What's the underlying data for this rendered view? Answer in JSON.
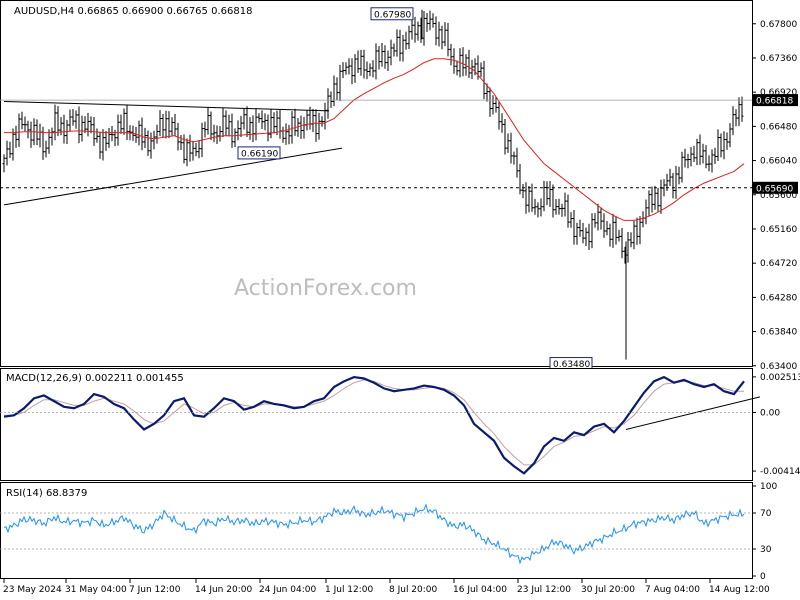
{
  "header": {
    "symbol": "AUDUSD,H4",
    "ohlc": "0.66865 0.66900 0.66765 0.66818"
  },
  "watermark": "ActionForex.com",
  "colors": {
    "bars": "#000000",
    "ma": "#e0201c",
    "macd_line": "#0a1a6e",
    "macd_signal": "#c0a0a0",
    "rsi": "#1e90ff",
    "grid": "#9a9a9a",
    "price_tag_bg": "#000000"
  },
  "chart_data": [
    {
      "type": "line",
      "name": "price",
      "title": "AUDUSD,H4",
      "ylim": [
        0.6341,
        0.6808
      ],
      "y_ticks": [
        "0.67800",
        "0.67360",
        "0.66920",
        "0.66480",
        "0.66040",
        "0.65600",
        "0.65160",
        "0.64720",
        "0.64280",
        "0.63840",
        "0.63400"
      ],
      "y_tick_values": [
        0.678,
        0.6736,
        0.6692,
        0.6648,
        0.6604,
        0.656,
        0.6516,
        0.6472,
        0.6428,
        0.6384,
        0.634
      ],
      "x_labels": [
        "23 May 2024",
        "31 May 04:00",
        "7 Jun 12:00",
        "14 Jun 20:00",
        "24 Jun 04:00",
        "1 Jul 12:00",
        "8 Jul 20:00",
        "16 Jul 04:00",
        "23 Jul 12:00",
        "30 Jul 20:00",
        "7 Aug 04:00",
        "14 Aug 12:00"
      ],
      "x": [
        0,
        10,
        20,
        30,
        40,
        50,
        60,
        70,
        80,
        90,
        100,
        110,
        120,
        130,
        140,
        150,
        160,
        170,
        180,
        190,
        200,
        210,
        220,
        230,
        240,
        250,
        260,
        270,
        280,
        290,
        300,
        310,
        320,
        330,
        340,
        350,
        360,
        370,
        380,
        390,
        400,
        410,
        420,
        430,
        440,
        450,
        460,
        470,
        480,
        490,
        500,
        510,
        520,
        530,
        540,
        550,
        560,
        570,
        580,
        590,
        600,
        610,
        620,
        630,
        640,
        650,
        660,
        670,
        680,
        690,
        700,
        710,
        720,
        730,
        740
      ],
      "close": [
        0.66,
        0.664,
        0.665,
        0.664,
        0.662,
        0.665,
        0.6648,
        0.6655,
        0.665,
        0.664,
        0.662,
        0.6645,
        0.665,
        0.664,
        0.663,
        0.663,
        0.666,
        0.664,
        0.662,
        0.661,
        0.665,
        0.664,
        0.665,
        0.664,
        0.6652,
        0.665,
        0.6655,
        0.665,
        0.664,
        0.6645,
        0.6655,
        0.665,
        0.666,
        0.67,
        0.6718,
        0.673,
        0.6722,
        0.6728,
        0.674,
        0.6745,
        0.676,
        0.677,
        0.678,
        0.6778,
        0.676,
        0.673,
        0.6725,
        0.673,
        0.67,
        0.667,
        0.664,
        0.66,
        0.656,
        0.654,
        0.656,
        0.655,
        0.654,
        0.652,
        0.65,
        0.653,
        0.652,
        0.651,
        0.649,
        0.6505,
        0.654,
        0.6555,
        0.657,
        0.658,
        0.66,
        0.662,
        0.6605,
        0.661,
        0.663,
        0.6655,
        0.6682
      ],
      "ma": [
        0.664,
        0.664,
        0.6641,
        0.6641,
        0.664,
        0.664,
        0.6641,
        0.6642,
        0.6642,
        0.6641,
        0.664,
        0.664,
        0.664,
        0.6639,
        0.6634,
        0.6632,
        0.6634,
        0.6636,
        0.6631,
        0.6628,
        0.6631,
        0.6634,
        0.6636,
        0.6636,
        0.6637,
        0.6638,
        0.6639,
        0.664,
        0.6642,
        0.6646,
        0.665,
        0.6652,
        0.6652,
        0.6658,
        0.667,
        0.6682,
        0.669,
        0.6697,
        0.6704,
        0.671,
        0.6715,
        0.6722,
        0.673,
        0.6735,
        0.6735,
        0.6733,
        0.6728,
        0.672,
        0.6705,
        0.669,
        0.667,
        0.665,
        0.663,
        0.6615,
        0.66,
        0.659,
        0.658,
        0.657,
        0.656,
        0.655,
        0.654,
        0.6533,
        0.6527,
        0.6527,
        0.653,
        0.6535,
        0.6542,
        0.655,
        0.656,
        0.6568,
        0.6575,
        0.658,
        0.6585,
        0.659,
        0.66
      ],
      "price_tags": [
        "0.66818",
        "0.65690"
      ],
      "price_tag_values": [
        0.66818,
        0.6569
      ],
      "annotations": [
        {
          "text": "0.67980",
          "x": 388,
          "y": 0.6798
        },
        {
          "text": "0.66190",
          "x": 255,
          "y": 0.6619
        },
        {
          "text": "0.63480",
          "x": 567,
          "y": 0.6348
        }
      ],
      "horizontal_level": 0.6569,
      "trendlines": [
        {
          "x0": 0,
          "y0": 0.668,
          "x1": 325,
          "y1": 0.6668
        },
        {
          "x0": 0,
          "y0": 0.6547,
          "x1": 338,
          "y1": 0.662
        }
      ]
    },
    {
      "type": "line",
      "name": "macd",
      "title": "MACD(12,26,9) 0.002211 0.001455",
      "ylim": [
        -0.0047,
        0.003
      ],
      "y_ticks": [
        "0.002513",
        "0.00",
        "-0.00414"
      ],
      "y_tick_values": [
        0.002513,
        0.0,
        -0.00414
      ],
      "x": [
        0,
        10,
        20,
        30,
        40,
        50,
        60,
        70,
        80,
        90,
        100,
        110,
        120,
        130,
        140,
        150,
        160,
        170,
        180,
        190,
        200,
        210,
        220,
        230,
        240,
        250,
        260,
        270,
        280,
        290,
        300,
        310,
        320,
        330,
        340,
        350,
        360,
        370,
        380,
        390,
        400,
        410,
        420,
        430,
        440,
        450,
        460,
        470,
        480,
        490,
        500,
        510,
        520,
        530,
        540,
        550,
        560,
        570,
        580,
        590,
        600,
        610,
        620,
        630,
        640,
        650,
        660,
        670,
        680,
        690,
        700,
        710,
        720,
        730,
        740
      ],
      "macd": [
        -0.0003,
        -0.0002,
        0.0003,
        0.001,
        0.0012,
        0.0008,
        0.0004,
        0.0003,
        0.0006,
        0.0013,
        0.0011,
        0.0006,
        0.0003,
        -0.0005,
        -0.0012,
        -0.0008,
        -0.0002,
        0.0008,
        0.001,
        -0.0002,
        -0.0003,
        0.0003,
        0.001,
        0.0008,
        0.0002,
        0.0004,
        0.0008,
        0.0006,
        0.0005,
        0.0003,
        0.0004,
        0.0008,
        0.001,
        0.0018,
        0.0022,
        0.0025,
        0.0024,
        0.0021,
        0.0017,
        0.0015,
        0.0016,
        0.0017,
        0.0019,
        0.0018,
        0.0016,
        0.0012,
        0.0005,
        -0.0008,
        -0.0014,
        -0.002,
        -0.0032,
        -0.0038,
        -0.0043,
        -0.0036,
        -0.0024,
        -0.0018,
        -0.002,
        -0.0014,
        -0.0016,
        -0.001,
        -0.0008,
        -0.0014,
        -0.0006,
        0.0004,
        0.0014,
        0.0022,
        0.0025,
        0.0021,
        0.0023,
        0.002,
        0.0018,
        0.002,
        0.0015,
        0.0013,
        0.0022
      ],
      "signal": [
        -0.0002,
        -0.0002,
        0.0,
        0.0005,
        0.0009,
        0.0009,
        0.0007,
        0.0005,
        0.0005,
        0.0008,
        0.001,
        0.0008,
        0.0006,
        0.0001,
        -0.0005,
        -0.0008,
        -0.0006,
        0.0,
        0.0006,
        0.0003,
        -0.0001,
        0.0,
        0.0005,
        0.0007,
        0.0005,
        0.0004,
        0.0006,
        0.0006,
        0.0005,
        0.0004,
        0.0004,
        0.0006,
        0.0008,
        0.0012,
        0.0017,
        0.0021,
        0.0023,
        0.0022,
        0.0019,
        0.0017,
        0.0016,
        0.0016,
        0.0017,
        0.0018,
        0.0017,
        0.0014,
        0.0009,
        0.0,
        -0.0008,
        -0.0015,
        -0.0024,
        -0.0031,
        -0.0037,
        -0.0037,
        -0.0031,
        -0.0024,
        -0.0021,
        -0.0017,
        -0.0016,
        -0.0013,
        -0.001,
        -0.0011,
        -0.0008,
        -0.0002,
        0.0007,
        0.0015,
        0.002,
        0.0021,
        0.0022,
        0.0021,
        0.0019,
        0.0019,
        0.0017,
        0.0015,
        0.0015
      ],
      "trendline": {
        "x0": 622,
        "y0": -0.0012,
        "x1": 756,
        "y1": 0.0011
      }
    },
    {
      "type": "line",
      "name": "rsi",
      "title": "RSI(14) 68.8379",
      "ylim": [
        0,
        100
      ],
      "y_ticks": [
        "100",
        "70",
        "30",
        "0"
      ],
      "y_tick_values": [
        100,
        70,
        30,
        0
      ],
      "levels": [
        70,
        30
      ],
      "x": [
        0,
        10,
        20,
        30,
        40,
        50,
        60,
        70,
        80,
        90,
        100,
        110,
        120,
        130,
        140,
        150,
        160,
        170,
        180,
        190,
        200,
        210,
        220,
        230,
        240,
        250,
        260,
        270,
        280,
        290,
        300,
        310,
        320,
        330,
        340,
        350,
        360,
        370,
        380,
        390,
        400,
        410,
        420,
        430,
        440,
        450,
        460,
        470,
        480,
        490,
        500,
        510,
        520,
        530,
        540,
        550,
        560,
        570,
        580,
        590,
        600,
        610,
        620,
        630,
        640,
        650,
        660,
        670,
        680,
        690,
        700,
        710,
        720,
        730,
        740
      ],
      "values": [
        52,
        56,
        63,
        62,
        58,
        65,
        60,
        61,
        59,
        62,
        56,
        60,
        65,
        56,
        50,
        58,
        70,
        62,
        55,
        50,
        62,
        58,
        64,
        60,
        62,
        58,
        61,
        60,
        57,
        59,
        62,
        60,
        65,
        72,
        70,
        74,
        68,
        70,
        73,
        69,
        66,
        70,
        75,
        72,
        62,
        55,
        57,
        50,
        40,
        36,
        30,
        22,
        18,
        25,
        30,
        38,
        35,
        28,
        32,
        38,
        42,
        48,
        52,
        58,
        60,
        62,
        65,
        62,
        68,
        70,
        58,
        62,
        66,
        68,
        69
      ]
    }
  ]
}
